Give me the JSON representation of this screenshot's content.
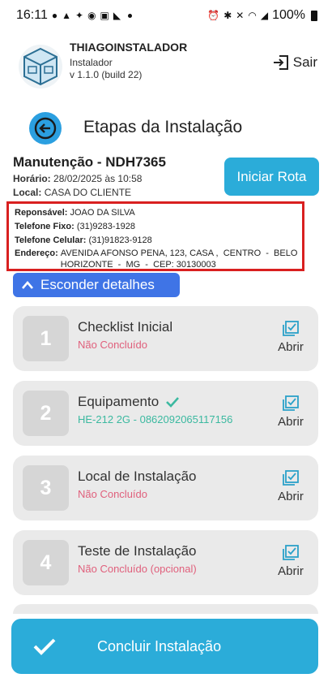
{
  "status_bar": {
    "time": "16:11",
    "battery_text": "100%"
  },
  "app": {
    "name": "THIAGOINSTALADOR",
    "subtitle": "Instalador",
    "version": "v 1.1.0 (build 22)",
    "logout_label": "Sair"
  },
  "page": {
    "title": "Etapas da Instalação"
  },
  "service": {
    "title": "Manutenção - NDH7365",
    "schedule_label": "Horário:",
    "schedule_value": "28/02/2025 às 10:58",
    "location_label": "Local:",
    "location_value": "CASA DO CLIENTE",
    "start_route_label": "Iniciar Rota"
  },
  "details": {
    "responsible_label": "Reponsável:",
    "responsible_value": "JOAO DA SILVA",
    "landline_label": "Telefone Fixo:",
    "landline_value": "(31)9283-1928",
    "mobile_label": "Telefone Celular:",
    "mobile_value": "(31)91823-9128",
    "address_label": "Endereço:",
    "address_value": "AVENIDA AFONSO PENA, 123, CASA ,  CENTRO  -  BELO\nHORIZONTE  -  MG  -  CEP: 30130003",
    "hide_label": "Esconder detalhes"
  },
  "steps": [
    {
      "number": "1",
      "title": "Checklist Inicial",
      "status": "Não Concluído",
      "completed": false,
      "open_label": "Abrir"
    },
    {
      "number": "2",
      "title": "Equipamento",
      "status": "HE-212 2G - 0862092065117156",
      "completed": true,
      "open_label": "Abrir"
    },
    {
      "number": "3",
      "title": "Local de Instalação",
      "status": "Não Concluído",
      "completed": false,
      "open_label": "Abrir"
    },
    {
      "number": "4",
      "title": "Teste de Instalação",
      "status": "Não Concluído (opcional)",
      "completed": false,
      "open_label": "Abrir"
    }
  ],
  "footer": {
    "finish_label": "Concluir Instalação"
  },
  "colors": {
    "primary": "#2bacd9",
    "button_blue": "#3f74e6",
    "pending": "#e0607c",
    "done": "#3bb9a0",
    "highlight_border": "#d92020"
  }
}
